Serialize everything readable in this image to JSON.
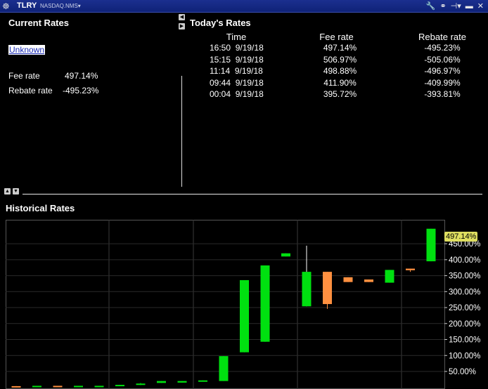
{
  "titlebar": {
    "symbol": "TLRY",
    "exchange": "NASDAQ.NMS"
  },
  "current_rates": {
    "title": "Current Rates",
    "status_link": "Unknown",
    "fee_label": "Fee rate",
    "fee_value": "497.14%",
    "rebate_label": "Rebate rate",
    "rebate_value": "-495.23%"
  },
  "todays_rates": {
    "title": "Today's Rates",
    "columns": [
      "Time",
      "Fee rate",
      "Rebate rate"
    ],
    "rows": [
      {
        "time": "16:50",
        "date": "9/19/18",
        "fee": "497.14%",
        "rebate": "-495.23%"
      },
      {
        "time": "15:15",
        "date": "9/19/18",
        "fee": "506.97%",
        "rebate": "-505.06%"
      },
      {
        "time": "11:14",
        "date": "9/19/18",
        "fee": "498.88%",
        "rebate": "-496.97%"
      },
      {
        "time": "09:44",
        "date": "9/19/18",
        "fee": "411.90%",
        "rebate": "-409.99%"
      },
      {
        "time": "00:04",
        "date": "9/19/18",
        "fee": "395.72%",
        "rebate": "-393.81%"
      }
    ]
  },
  "historical": {
    "title": "Historical Rates",
    "last_price_tag": "497.14%"
  },
  "colors": {
    "up": "#00e010",
    "down": "#ff9040",
    "titlebar": "#13268a",
    "tag": "#dede60"
  },
  "chart_data": {
    "type": "candlestick",
    "title": "Historical Rates",
    "y_unit": "%",
    "ylim": [
      -5,
      525
    ],
    "y_ticks": [
      "50.00%",
      "100.00%",
      "150.00%",
      "200.00%",
      "250.00%",
      "300.00%",
      "350.00%",
      "400.00%",
      "450.00%"
    ],
    "candles": [
      {
        "open": 4,
        "close": 2,
        "high": 4,
        "low": 2
      },
      {
        "open": 3,
        "close": 5,
        "high": 5,
        "low": 3
      },
      {
        "open": 5,
        "close": 3,
        "high": 5,
        "low": 3
      },
      {
        "open": 3,
        "close": 5,
        "high": 5,
        "low": 3
      },
      {
        "open": 3,
        "close": 5,
        "high": 5,
        "low": 3
      },
      {
        "open": 5,
        "close": 8,
        "high": 8,
        "low": 5
      },
      {
        "open": 8,
        "close": 12,
        "high": 14,
        "low": 7
      },
      {
        "open": 14,
        "close": 20,
        "high": 20,
        "low": 14
      },
      {
        "open": 15,
        "close": 20,
        "high": 20,
        "low": 15
      },
      {
        "open": 18,
        "close": 22,
        "high": 22,
        "low": 18
      },
      {
        "open": 20,
        "close": 98,
        "high": 98,
        "low": 20
      },
      {
        "open": 110,
        "close": 336,
        "high": 336,
        "low": 110
      },
      {
        "open": 143,
        "close": 382,
        "high": 382,
        "low": 143
      },
      {
        "open": 410,
        "close": 420,
        "high": 420,
        "low": 410
      },
      {
        "open": 254,
        "close": 362,
        "high": 444,
        "low": 254
      },
      {
        "open": 362,
        "close": 261,
        "high": 362,
        "low": 246
      },
      {
        "open": 345,
        "close": 330,
        "high": 345,
        "low": 330
      },
      {
        "open": 338,
        "close": 330,
        "high": 338,
        "low": 330
      },
      {
        "open": 328,
        "close": 368,
        "high": 368,
        "low": 328
      },
      {
        "open": 372,
        "close": 367,
        "high": 372,
        "low": 362
      },
      {
        "open": 395,
        "close": 497,
        "high": 497,
        "low": 395
      }
    ]
  }
}
